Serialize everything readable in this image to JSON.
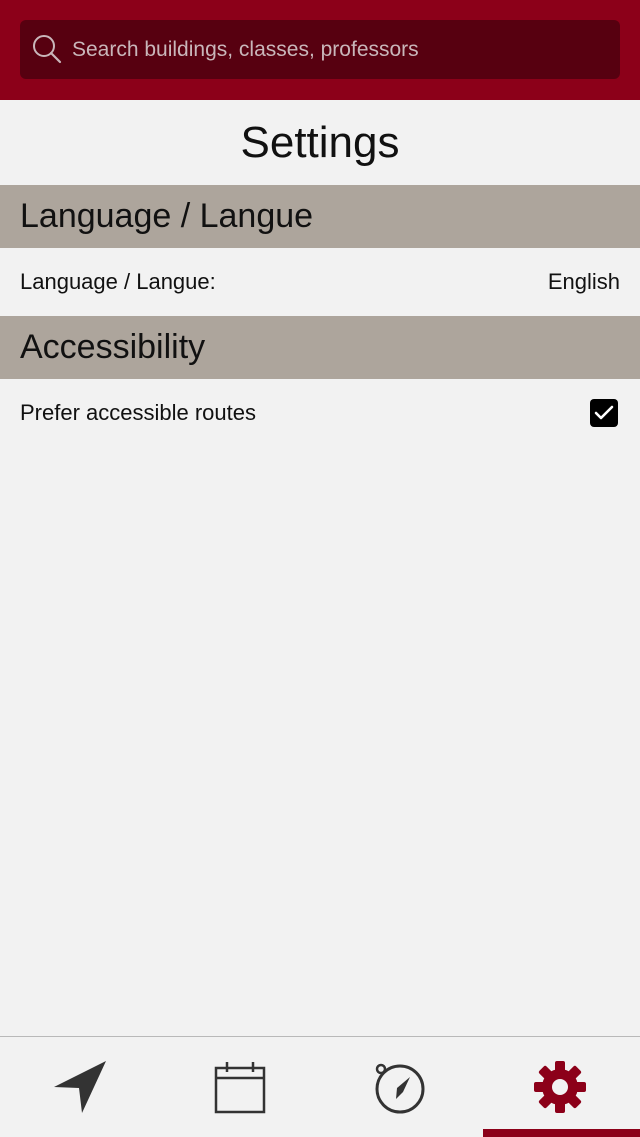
{
  "search": {
    "placeholder": "Search buildings, classes, professors",
    "icon": "search-icon"
  },
  "page": {
    "title": "Settings"
  },
  "sections": {
    "language": {
      "header": "Language / Langue",
      "row_label": "Language / Langue:",
      "row_value": "English"
    },
    "accessibility": {
      "header": "Accessibility",
      "row_label": "Prefer accessible routes",
      "checked": true
    }
  },
  "tabs": [
    {
      "icon": "navigation-arrow-icon",
      "active": false
    },
    {
      "icon": "calendar-icon",
      "active": false
    },
    {
      "icon": "compass-icon",
      "active": false
    },
    {
      "icon": "gear-icon",
      "active": true
    }
  ],
  "colors": {
    "brand": "#8c0019",
    "search_bg": "#570010",
    "section_header": "#ada59c",
    "background": "#f2f2f2"
  }
}
